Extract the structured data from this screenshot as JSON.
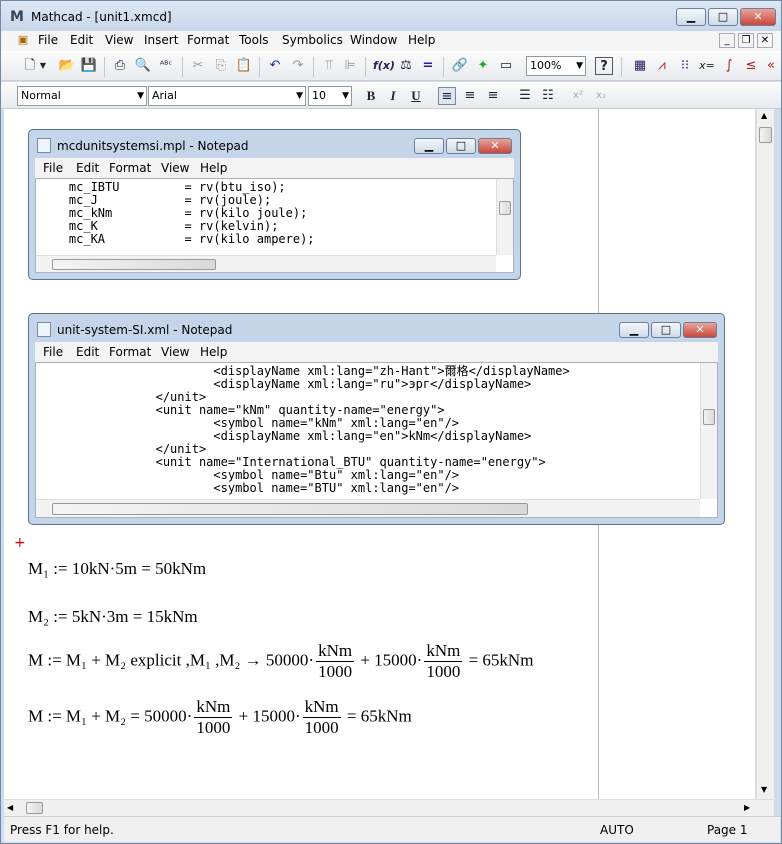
{
  "window": {
    "title": "Mathcad - [unit1.xmcd]"
  },
  "menu": [
    "File",
    "Edit",
    "View",
    "Insert",
    "Format",
    "Tools",
    "Symbolics",
    "Window",
    "Help"
  ],
  "toolbar": {
    "zoom": "100%"
  },
  "formatbar": {
    "style": "Normal",
    "font": "Arial",
    "size": "10",
    "superscript": "x²",
    "subscript": "x₂"
  },
  "notepad1": {
    "title": "mcdunitsystemsi.mpl - Notepad",
    "menu": [
      "File",
      "Edit",
      "Format",
      "View",
      "Help"
    ],
    "lines": [
      "    mc_IBTU         = rv(btu_iso);",
      "    mc_J            = rv(joule);",
      "    mc_kNm          = rv(kilo joule);",
      "    mc_K            = rv(kelvin);",
      "    mc_KA           = rv(kilo ampere);"
    ]
  },
  "notepad2": {
    "title": "unit-system-SI.xml - Notepad",
    "menu": [
      "File",
      "Edit",
      "Format",
      "View",
      "Help"
    ],
    "lines": [
      "                        <displayName xml:lang=\"zh-Hant\">爾格</displayName>",
      "                        <displayName xml:lang=\"ru\">эрг</displayName>",
      "                </unit>",
      "                <unit name=\"kNm\" quantity-name=\"energy\">",
      "                        <symbol name=\"kNm\" xml:lang=\"en\"/>",
      "                        <displayName xml:lang=\"en\">kNm</displayName>",
      "                </unit>",
      "                <unit name=\"International_BTU\" quantity-name=\"energy\">",
      "                        <symbol name=\"Btu\" xml:lang=\"en\"/>",
      "                        <symbol name=\"BTU\" xml:lang=\"en\"/>"
    ]
  },
  "math": {
    "eq1": "M₁ := 10kN·5m = 50kNm",
    "eq2": "M₂ := 5kN·3m = 15kNm",
    "eq3a": "M := M₁ + M₂ explicit ,M₁ ,M₂  → 50000·",
    "eq3n": "kNm",
    "eq3d": "1000",
    "eq3b": " + 15000·",
    "eq3c": " = 65kNm",
    "eq4a": "M := M₁ + M₂ =  50000·",
    "eq4b": " + 15000·",
    "eq4c": " = 65kNm"
  },
  "status": {
    "help": "Press F1 for help.",
    "mode": "AUTO",
    "page": "Page 1"
  }
}
